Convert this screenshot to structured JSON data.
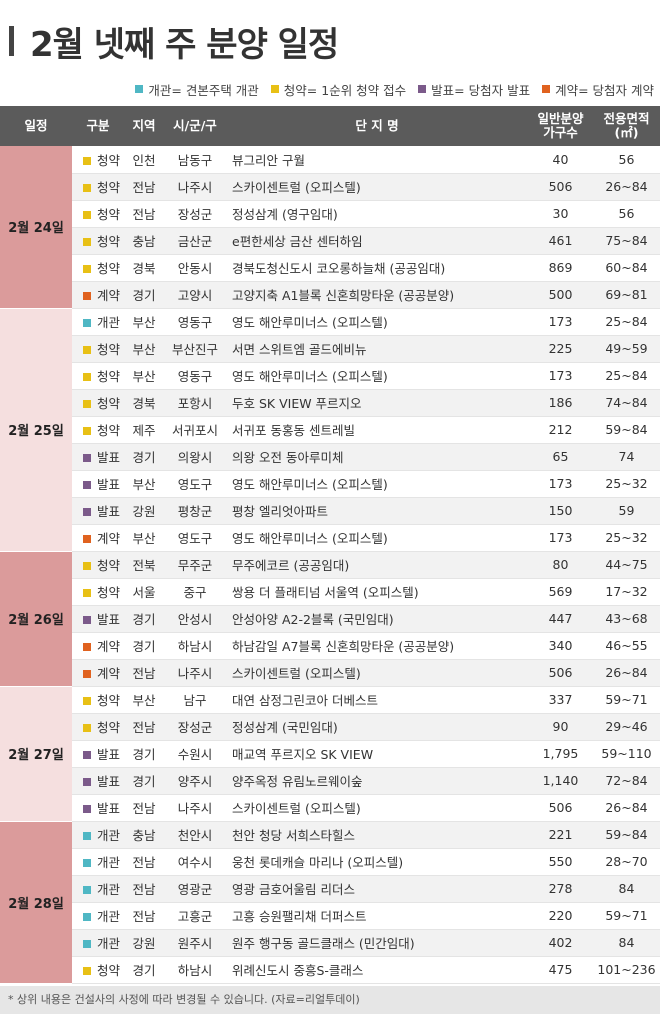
{
  "title": "2월 넷째 주 분양 일정",
  "legend": [
    {
      "text": "개관= 견본주택 개관",
      "color": "#4fb7c4"
    },
    {
      "text": "청약= 1순위 청약 접수",
      "color": "#e8c015"
    },
    {
      "text": "발표= 당첨자 발표",
      "color": "#7b5a8a"
    },
    {
      "text": "계약= 당첨자 계약",
      "color": "#e0621f"
    }
  ],
  "colors": {
    "개관": "#4fb7c4",
    "청약": "#e8c015",
    "발표": "#7b5a8a",
    "계약": "#e0621f"
  },
  "headers": [
    "일정",
    "구분",
    "지역",
    "시/군/구",
    "단 지 명",
    "일반분양\n가구수",
    "전용면적\n(㎡)"
  ],
  "groups": [
    {
      "date": "2월 24일",
      "shade": "dark",
      "rows": [
        [
          "청약",
          "인천",
          "남동구",
          "뷰그리안 구월",
          "40",
          "56"
        ],
        [
          "청약",
          "전남",
          "나주시",
          "스카이센트럴 (오피스텔)",
          "506",
          "26~84"
        ],
        [
          "청약",
          "전남",
          "장성군",
          "정성삼계 (영구임대)",
          "30",
          "56"
        ],
        [
          "청약",
          "충남",
          "금산군",
          "e편한세상 금산 센터하임",
          "461",
          "75~84"
        ],
        [
          "청약",
          "경북",
          "안동시",
          "경북도청신도시 코오롱하늘채 (공공임대)",
          "869",
          "60~84"
        ],
        [
          "계약",
          "경기",
          "고양시",
          "고양지축 A1블록 신혼희망타운 (공공분양)",
          "500",
          "69~81"
        ]
      ]
    },
    {
      "date": "2월 25일",
      "shade": "light",
      "rows": [
        [
          "개관",
          "부산",
          "영동구",
          "영도 해안루미너스 (오피스텔)",
          "173",
          "25~84"
        ],
        [
          "청약",
          "부산",
          "부산진구",
          "서면 스위트엠 골드에비뉴",
          "225",
          "49~59"
        ],
        [
          "청약",
          "부산",
          "영동구",
          "영도 해안루미너스 (오피스텔)",
          "173",
          "25~84"
        ],
        [
          "청약",
          "경북",
          "포항시",
          "두호 SK VIEW 푸르지오",
          "186",
          "74~84"
        ],
        [
          "청약",
          "제주",
          "서귀포시",
          "서귀포 동홍동 센트레빌",
          "212",
          "59~84"
        ],
        [
          "발표",
          "경기",
          "의왕시",
          "의왕 오전 동아루미체",
          "65",
          "74"
        ],
        [
          "발표",
          "부산",
          "영도구",
          "영도 해안루미너스 (오피스텔)",
          "173",
          "25~32"
        ],
        [
          "발표",
          "강원",
          "평창군",
          "평창 엘리엇아파트",
          "150",
          "59"
        ],
        [
          "계약",
          "부산",
          "영도구",
          "영도 해안루미너스 (오피스텔)",
          "173",
          "25~32"
        ]
      ]
    },
    {
      "date": "2월 26일",
      "shade": "dark",
      "rows": [
        [
          "청약",
          "전북",
          "무주군",
          "무주에코르 (공공임대)",
          "80",
          "44~75"
        ],
        [
          "청약",
          "서울",
          "중구",
          "쌍용 더 플래티넘 서울역 (오피스텔)",
          "569",
          "17~32"
        ],
        [
          "발표",
          "경기",
          "안성시",
          "안성아양 A2-2블록 (국민임대)",
          "447",
          "43~68"
        ],
        [
          "계약",
          "경기",
          "하남시",
          "하남감일 A7블록 신혼희망타운 (공공분양)",
          "340",
          "46~55"
        ],
        [
          "계약",
          "전남",
          "나주시",
          "스카이센트럴 (오피스텔)",
          "506",
          "26~84"
        ]
      ]
    },
    {
      "date": "2월 27일",
      "shade": "light",
      "rows": [
        [
          "청약",
          "부산",
          "남구",
          "대연 삼정그린코아 더베스트",
          "337",
          "59~71"
        ],
        [
          "청약",
          "전남",
          "장성군",
          "정성삼계 (국민임대)",
          "90",
          "29~46"
        ],
        [
          "발표",
          "경기",
          "수원시",
          "매교역 푸르지오 SK VIEW",
          "1,795",
          "59~110"
        ],
        [
          "발표",
          "경기",
          "양주시",
          "양주옥정 유림노르웨이숲",
          "1,140",
          "72~84"
        ],
        [
          "발표",
          "전남",
          "나주시",
          "스카이센트럴 (오피스텔)",
          "506",
          "26~84"
        ]
      ]
    },
    {
      "date": "2월 28일",
      "shade": "dark",
      "rows": [
        [
          "개관",
          "충남",
          "천안시",
          "천안 청당 서희스타힐스",
          "221",
          "59~84"
        ],
        [
          "개관",
          "전남",
          "여수시",
          "웅천 롯데캐슬 마리나 (오피스텔)",
          "550",
          "28~70"
        ],
        [
          "개관",
          "전남",
          "영광군",
          "영광 금호어울림 리더스",
          "278",
          "84"
        ],
        [
          "개관",
          "전남",
          "고흥군",
          "고흥 승원팰리채 더퍼스트",
          "220",
          "59~71"
        ],
        [
          "개관",
          "강원",
          "원주시",
          "원주 행구동 골드클래스 (민간임대)",
          "402",
          "84"
        ],
        [
          "청약",
          "경기",
          "하남시",
          "위례신도시 중흥S-클래스",
          "475",
          "101~236"
        ]
      ]
    }
  ],
  "footnote": "* 상위 내용은 건설사의 사정에 따라 변경될 수 있습니다. (자료=리얼투데이)"
}
